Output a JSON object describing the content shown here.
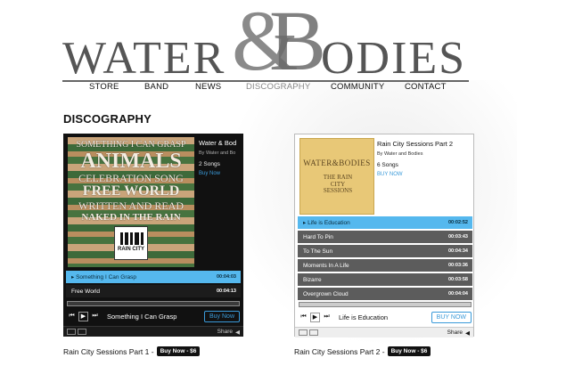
{
  "logo": {
    "left": "WATER",
    "amp": "&",
    "right": "ODIES"
  },
  "nav": [
    {
      "label": "STORE",
      "active": false
    },
    {
      "label": "BAND",
      "active": false
    },
    {
      "label": "NEWS",
      "active": false
    },
    {
      "label": "DISCOGRAPHY",
      "active": true
    },
    {
      "label": "COMMUNITY",
      "active": false
    },
    {
      "label": "CONTACT",
      "active": false
    }
  ],
  "page_title": "DISCOGRAPHY",
  "players": [
    {
      "cover_lines": [
        "SOMETHING I CAN GRASP",
        "ANIMALS",
        "CELEBRATION SONG",
        "FREE WORLD",
        "WRITTEN AND READ",
        "NAKED IN THE RAIN"
      ],
      "cover_badge": "RAIN CITY",
      "title": "Water & Bod",
      "by": "By Water and Bo",
      "songs": "2 Songs",
      "buy_link": "Buy Now",
      "tracks": [
        {
          "name": "Something I Can Grasp",
          "duration": "00:04:03",
          "selected": true
        },
        {
          "name": "Free World",
          "duration": "00:04:13",
          "selected": false
        }
      ],
      "now_playing": "Something I Can Grasp",
      "buy_button": "Buy Now",
      "share": "Share",
      "caption": "Rain City Sessions Part 1 -",
      "caption_buy": "Buy Now - $6"
    },
    {
      "cover_title": "WATER&BODIES",
      "cover_sub": "THE RAIN CITY SESSIONS",
      "title": "Rain City Sessions Part 2",
      "by": "By Water and Bodies",
      "songs": "6 Songs",
      "buy_link": "BUY NOW",
      "tracks": [
        {
          "name": "Life is Education",
          "duration": "00:02:52",
          "selected": true
        },
        {
          "name": "Hard To Pin",
          "duration": "00:03:43",
          "selected": false
        },
        {
          "name": "To The Sun",
          "duration": "00:04:34",
          "selected": false
        },
        {
          "name": "Moments In A Life",
          "duration": "00:03:36",
          "selected": false
        },
        {
          "name": "Bizarre",
          "duration": "00:03:58",
          "selected": false
        },
        {
          "name": "Overgrown Cloud",
          "duration": "00:04:04",
          "selected": false
        }
      ],
      "now_playing": "Life is Education",
      "buy_button": "BUY NOW",
      "share": "Share",
      "caption": "Rain City Sessions Part 2 -",
      "caption_buy": "Buy Now - $6"
    }
  ],
  "colors": {
    "accent": "#55b8ee",
    "link": "#3a9ad9"
  }
}
